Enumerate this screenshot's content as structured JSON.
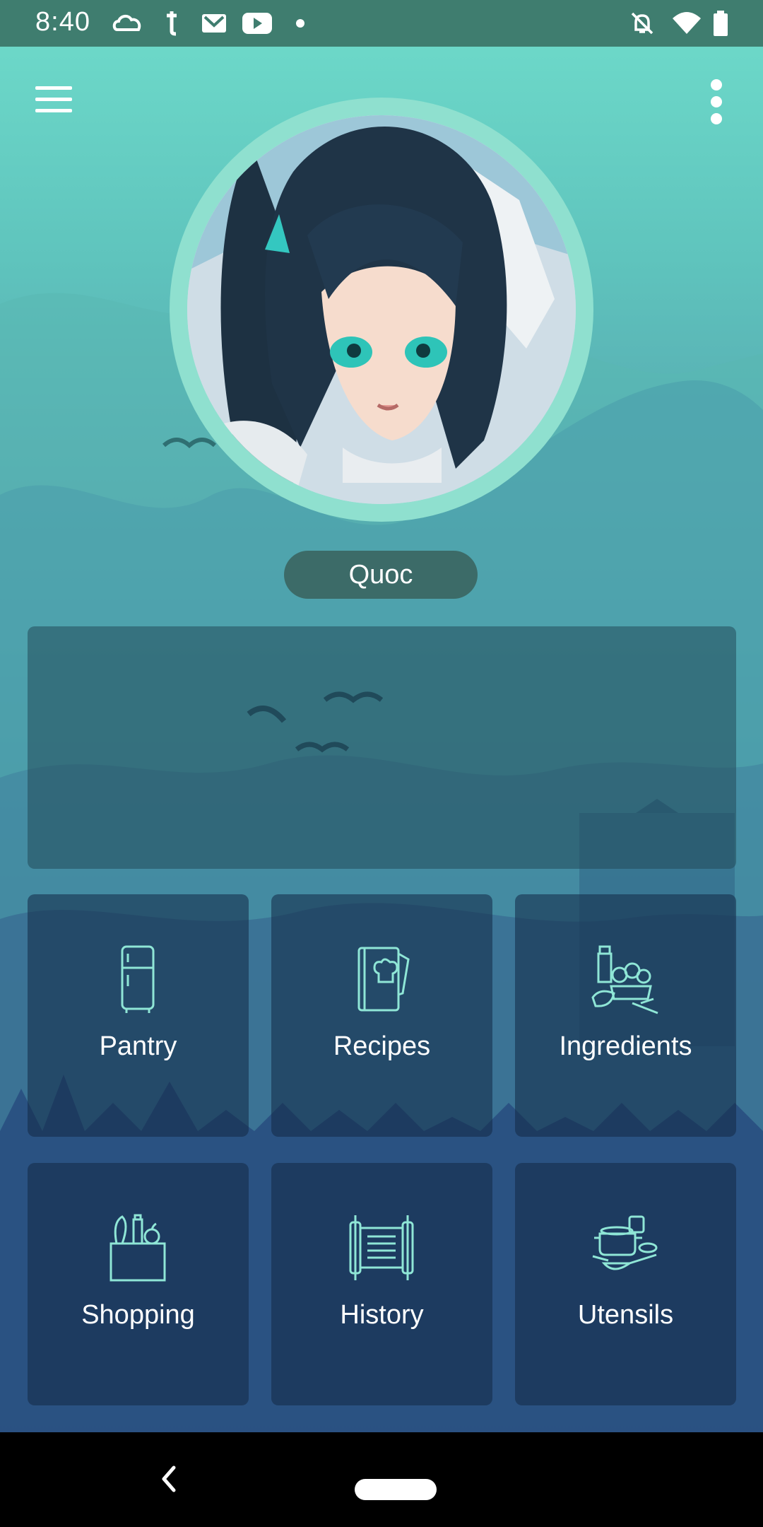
{
  "status_bar": {
    "time": "8:40",
    "left_icons": [
      "creative-cloud-icon",
      "tumblr-icon",
      "gmail-icon",
      "youtube-icon",
      "dot-icon"
    ],
    "right_icons": [
      "bell-off-icon",
      "wifi-icon",
      "battery-icon"
    ]
  },
  "app_bar": {
    "menu_icon": "hamburger-menu-icon",
    "overflow_icon": "more-vert-icon"
  },
  "profile": {
    "name": "Quoc",
    "avatar_icon": "anime-avatar"
  },
  "tiles": [
    {
      "label": "Pantry",
      "icon": "fridge-icon"
    },
    {
      "label": "Recipes",
      "icon": "recipe-book-icon"
    },
    {
      "label": "Ingredients",
      "icon": "ingredients-icon"
    },
    {
      "label": "Shopping",
      "icon": "grocery-bag-icon"
    },
    {
      "label": "History",
      "icon": "scroll-icon"
    },
    {
      "label": "Utensils",
      "icon": "cookware-icon"
    }
  ],
  "colors": {
    "accent": "#8fe0cf",
    "icon_stroke": "#8fe6d6",
    "status_bar": "#3f7d6f"
  }
}
